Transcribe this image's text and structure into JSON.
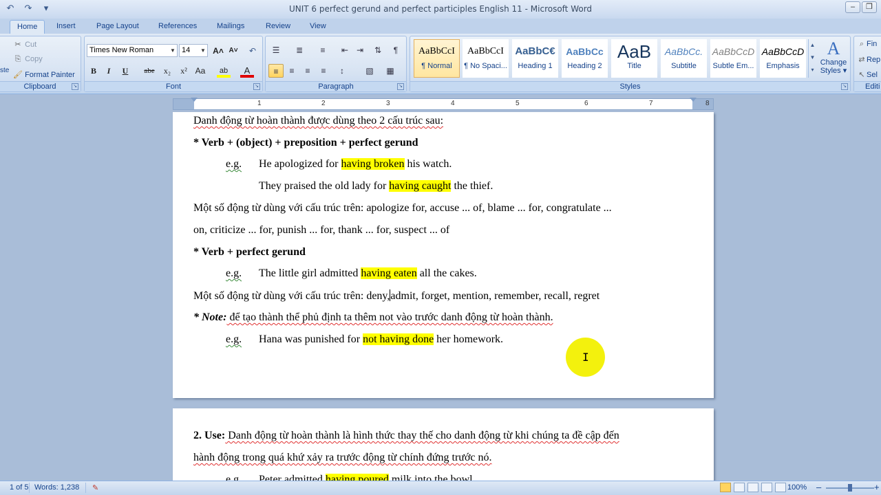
{
  "window": {
    "title": "UNIT 6 perfect gerund and perfect participles English 11  -  Microsoft Word",
    "controls": [
      "–",
      "❐",
      "✕"
    ]
  },
  "qat": {
    "undo": "↶",
    "redo": "↷",
    "more": "▾"
  },
  "tabs": [
    "Home",
    "Insert",
    "Page Layout",
    "References",
    "Mailings",
    "Review",
    "View"
  ],
  "clipboard": {
    "cut": "Cut",
    "copy": "Copy",
    "format_painter": "Format Painter",
    "label": "Clipboard",
    "paste": "ste"
  },
  "font": {
    "name": "Times New Roman",
    "size": "14",
    "label": "Font",
    "grow": "A˄",
    "shrink": "A˅",
    "clear": "↶",
    "bold": "B",
    "italic": "I",
    "underline": "U",
    "strike": "abe",
    "subscript": "x₂",
    "superscript": "x²",
    "change_case": "Aa",
    "highlight": "ab",
    "font_color": "A"
  },
  "paragraph": {
    "label": "Paragraph",
    "bullets": "☰",
    "numbering": "≣",
    "multilevel": "≡",
    "dec_indent": "⇤",
    "inc_indent": "⇥",
    "sort": "⇅",
    "show_marks": "¶",
    "align_left": "≡",
    "center": "≡",
    "align_right": "≡",
    "justify": "≡",
    "line_spacing": "↕",
    "shading": "▧",
    "borders": "▦"
  },
  "styles": {
    "label": "Styles",
    "items": [
      {
        "sample": "AaBbCcI",
        "name": "¶ Normal"
      },
      {
        "sample": "AaBbCcI",
        "name": "¶ No Spaci..."
      },
      {
        "sample": "AaBbC€",
        "name": "Heading 1"
      },
      {
        "sample": "AaBbCc",
        "name": "Heading 2"
      },
      {
        "sample": "AaB",
        "name": "Title"
      },
      {
        "sample": "AaBbCc.",
        "name": "Subtitle"
      },
      {
        "sample": "AaBbCcD",
        "name": "Subtle Em..."
      },
      {
        "sample": "AaBbCcD",
        "name": "Emphasis"
      }
    ],
    "change_styles": "Change Styles",
    "change_styles_line1": "Change",
    "change_styles_line2": "Styles ▾"
  },
  "editing": {
    "find": "Fin",
    "replace": "Rep",
    "select": "Sel",
    "label": "Editi"
  },
  "ruler": {
    "numbers": [
      "1",
      "2",
      "3",
      "4",
      "5",
      "6",
      "7",
      "8"
    ]
  },
  "document": {
    "page1": {
      "l1": "Danh động từ hoàn thành được dùng theo 2 cấu trúc sau:",
      "l2": "* Verb + (object) + preposition + perfect gerund",
      "eg": "e.g.",
      "l3_a": "He apologized for ",
      "l3_hl": "having broken",
      "l3_b": " his watch.",
      "l4_a": "They praised the old lady for ",
      "l4_hl": "having caught",
      "l4_b": " the thief.",
      "l5": "Một số động từ dùng với cấu trúc trên: apologize for, accuse ... of, blame ... for, congratulate ...",
      "l6": "on, criticize ... for, punish ... for, thank ... for, suspect ... of",
      "l7": "* Verb + perfect gerund",
      "l8_a": "The little girl admitted ",
      "l8_hl": "having eaten",
      "l8_b": " all the cakes.",
      "l9_a": "Một số động từ dùng với cấu trúc trên: deny,",
      "l9_b": "admit, forget, mention, remember, recall, regret",
      "l10_note": "* Note:",
      "l10_rest": " để tạo thành thể phủ định ta thêm not vào trước danh động từ hoàn thành.",
      "l11_a": "Hana was punished for ",
      "l11_hl": "not having done",
      "l11_b": " her homework."
    },
    "page2": {
      "l1_bold": "2. Use:",
      "l1_rest": " Danh động từ hoàn thành là hình thức thay thế cho danh động từ khi chúng ta đề cập đến",
      "l2": "hành động trong quá khứ xảy ra trước động từ chính đứng trước nó.",
      "eg": "e.g.",
      "l3_a": "Peter admitted ",
      "l3_hl": "having poured",
      "l3_b": " milk into the bowl."
    }
  },
  "status": {
    "page": "1 of 5",
    "words": "Words: 1,238",
    "zoom": "100%",
    "zoom_minus": "–",
    "zoom_plus": "+"
  },
  "colors": {
    "highlight": "#ffff00",
    "ribbon_text": "#15428b",
    "cursor_halo": "#f2f000"
  }
}
